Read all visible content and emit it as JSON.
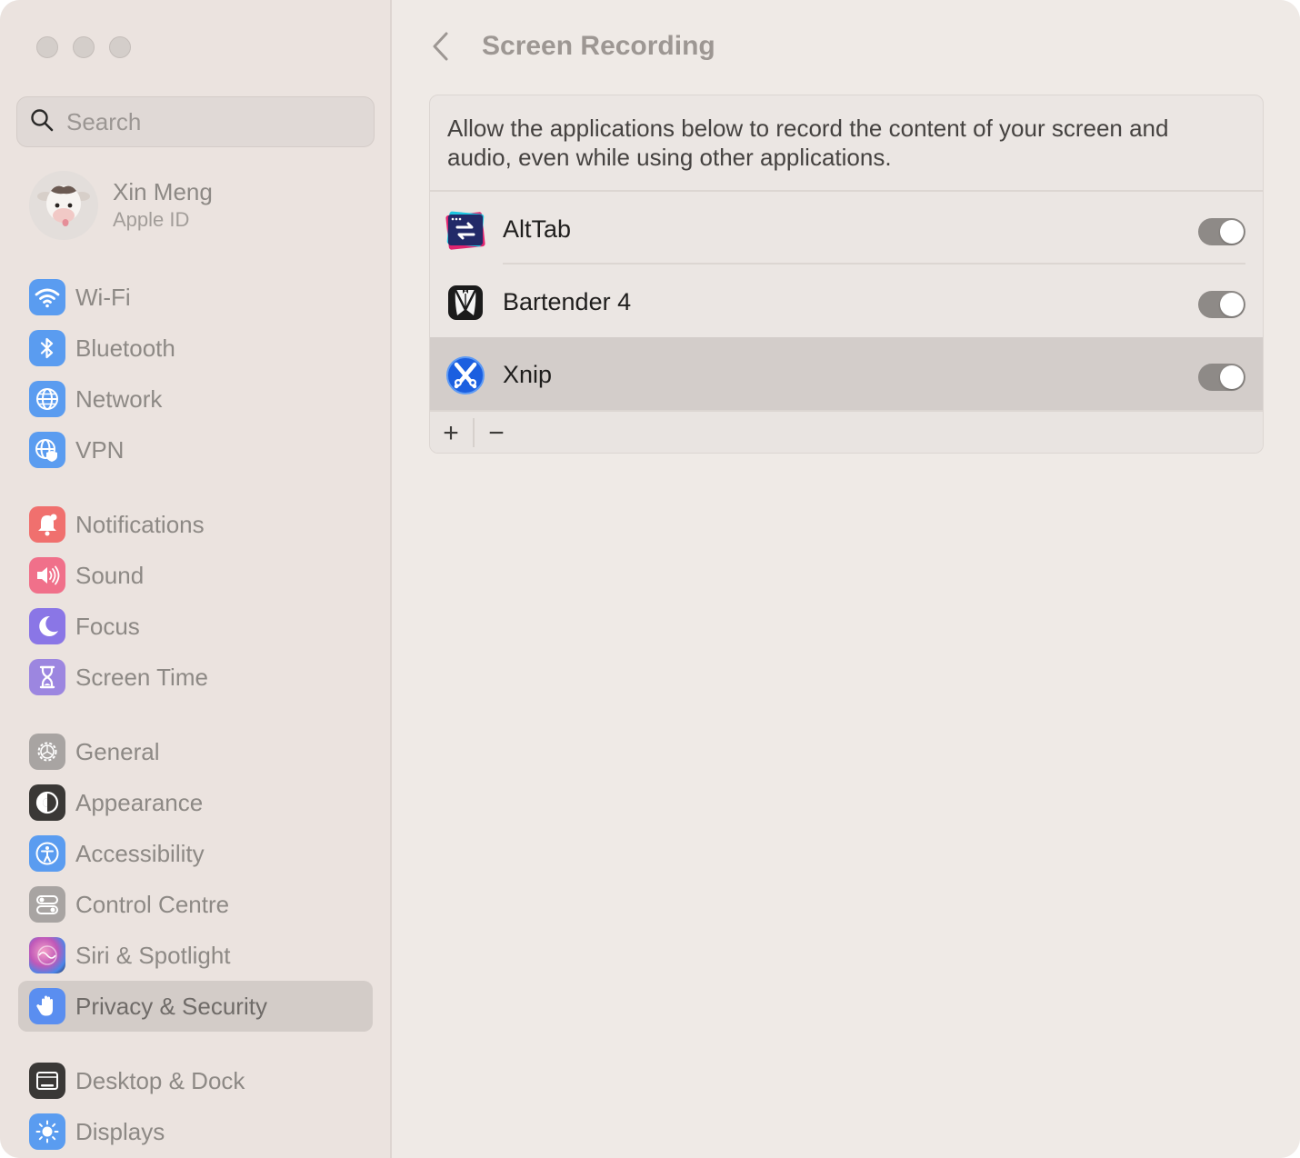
{
  "search": {
    "placeholder": "Search"
  },
  "profile": {
    "name": "Xin Meng",
    "subtitle": "Apple ID"
  },
  "sidebar": {
    "items": [
      {
        "label": "Wi-Fi",
        "icon": "wifi-icon",
        "color": "#5a9cf0"
      },
      {
        "label": "Bluetooth",
        "icon": "bluetooth-icon",
        "color": "#5a9cf0"
      },
      {
        "label": "Network",
        "icon": "globe-icon",
        "color": "#5a9cf0"
      },
      {
        "label": "VPN",
        "icon": "vpn-globe-icon",
        "color": "#5a9cf0"
      },
      {
        "label": "Notifications",
        "icon": "bell-icon",
        "color": "#f0706e"
      },
      {
        "label": "Sound",
        "icon": "speaker-icon",
        "color": "#f0708a"
      },
      {
        "label": "Focus",
        "icon": "moon-icon",
        "color": "#8a76e6"
      },
      {
        "label": "Screen Time",
        "icon": "hourglass-icon",
        "color": "#9c86e0"
      },
      {
        "label": "General",
        "icon": "gear-icon",
        "color": "#a8a4a2"
      },
      {
        "label": "Appearance",
        "icon": "appearance-icon",
        "color": "#3a3836"
      },
      {
        "label": "Accessibility",
        "icon": "accessibility-icon",
        "color": "#5a9cf0"
      },
      {
        "label": "Control Centre",
        "icon": "control-centre-icon",
        "color": "#a8a4a2"
      },
      {
        "label": "Siri & Spotlight",
        "icon": "siri-icon",
        "color": "#c058b8"
      },
      {
        "label": "Privacy & Security",
        "icon": "hand-icon",
        "color": "#5a8ef0"
      },
      {
        "label": "Desktop & Dock",
        "icon": "dock-icon",
        "color": "#3a3836"
      },
      {
        "label": "Displays",
        "icon": "sun-icon",
        "color": "#5a9cf0"
      }
    ]
  },
  "main": {
    "title": "Screen Recording",
    "description": "Allow the applications below to record the content of your screen and audio, even while using other applications.",
    "apps": [
      {
        "name": "AltTab",
        "icon": "alttab-icon",
        "enabled": true
      },
      {
        "name": "Bartender 4",
        "icon": "bartender-icon",
        "enabled": true
      },
      {
        "name": "Xnip",
        "icon": "xnip-icon",
        "enabled": true
      }
    ],
    "add_label": "+",
    "remove_label": "−"
  }
}
